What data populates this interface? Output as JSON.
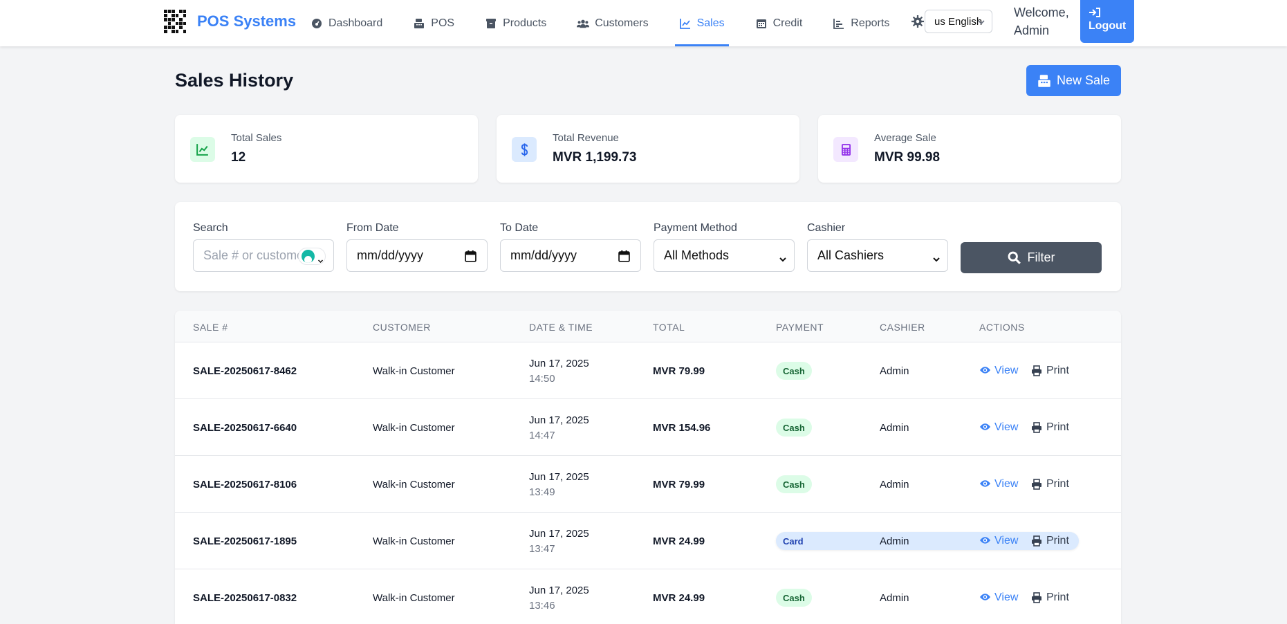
{
  "nav": {
    "brand": "POS Systems",
    "items": [
      {
        "label": "Dashboard",
        "icon": "dashboard-icon"
      },
      {
        "label": "POS",
        "icon": "cash-register-icon"
      },
      {
        "label": "Products",
        "icon": "box-icon"
      },
      {
        "label": "Customers",
        "icon": "users-icon"
      },
      {
        "label": "Sales",
        "icon": "chart-line-icon",
        "active": true
      },
      {
        "label": "Credit",
        "icon": "calendar-icon"
      },
      {
        "label": "Reports",
        "icon": "bar-chart-icon"
      }
    ],
    "language": "us English",
    "welcome_line1": "Welcome,",
    "welcome_line2": "Admin",
    "logout": "Logout",
    "accent": "#3b82f6"
  },
  "header": {
    "title": "Sales History",
    "new_sale": "New Sale"
  },
  "stats": [
    {
      "label": "Total Sales",
      "value": "12",
      "icon": "chart-line-icon",
      "color": "#16a34a",
      "bg": "#dcfce7"
    },
    {
      "label": "Total Revenue",
      "value": "MVR 1,199.73",
      "icon": "dollar-icon",
      "color": "#2563eb",
      "bg": "#dbeafe"
    },
    {
      "label": "Average Sale",
      "value": "MVR 99.98",
      "icon": "calculator-icon",
      "color": "#9333ea",
      "bg": "#f3e8ff"
    }
  ],
  "filters": {
    "search_label": "Search",
    "search_placeholder": "Sale # or custome",
    "from_label": "From Date",
    "from_value": "mm/dd/yyyy",
    "to_label": "To Date",
    "to_value": "mm/dd/yyyy",
    "payment_label": "Payment Method",
    "payment_value": "All Methods",
    "cashier_label": "Cashier",
    "cashier_value": "All Cashiers",
    "filter_button": "Filter"
  },
  "table": {
    "columns": [
      "SALE #",
      "CUSTOMER",
      "DATE & TIME",
      "TOTAL",
      "PAYMENT",
      "CASHIER",
      "ACTIONS"
    ],
    "view_label": "View",
    "print_label": "Print",
    "rows": [
      {
        "sale": "SALE-20250617-8462",
        "customer": "Walk-in Customer",
        "date": "Jun 17, 2025",
        "time": "14:50",
        "total": "MVR 79.99",
        "payment": "Cash",
        "cashier": "Admin"
      },
      {
        "sale": "SALE-20250617-6640",
        "customer": "Walk-in Customer",
        "date": "Jun 17, 2025",
        "time": "14:47",
        "total": "MVR 154.96",
        "payment": "Cash",
        "cashier": "Admin"
      },
      {
        "sale": "SALE-20250617-8106",
        "customer": "Walk-in Customer",
        "date": "Jun 17, 2025",
        "time": "13:49",
        "total": "MVR 79.99",
        "payment": "Cash",
        "cashier": "Admin"
      },
      {
        "sale": "SALE-20250617-1895",
        "customer": "Walk-in Customer",
        "date": "Jun 17, 2025",
        "time": "13:47",
        "total": "MVR 24.99",
        "payment": "Card",
        "cashier": "Admin"
      },
      {
        "sale": "SALE-20250617-0832",
        "customer": "Walk-in Customer",
        "date": "Jun 17, 2025",
        "time": "13:46",
        "total": "MVR 24.99",
        "payment": "Cash",
        "cashier": "Admin"
      }
    ]
  }
}
